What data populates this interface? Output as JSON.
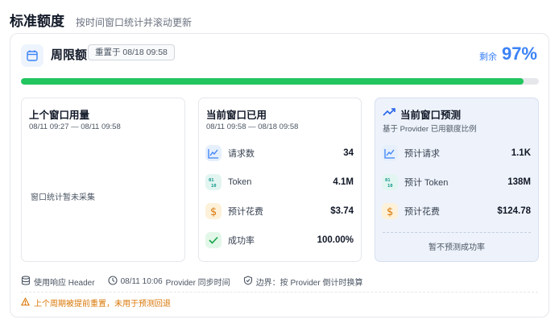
{
  "header": {
    "title": "标准额度",
    "subtitle": "按时间窗口统计并滚动更新"
  },
  "quota": {
    "title": "周限额",
    "reset_badge": "重置于 08/18 09:58",
    "remaining_label": "剩余",
    "remaining_value": "97%",
    "progress_fraction": 0.97,
    "progress_color": "#22c55e",
    "accent_color": "#3b82f6"
  },
  "previous_window": {
    "title": "上个窗口用量",
    "range": "08/11 09:27 — 08/11 09:58",
    "empty_text": "窗口统计暂未采集"
  },
  "current_window": {
    "title": "当前窗口已用",
    "range": "08/11 09:58 — 08/18 09:58",
    "rows": [
      {
        "icon": "chart-line-icon",
        "label": "请求数",
        "value": "34"
      },
      {
        "icon": "binary-icon",
        "label": "Token",
        "value": "4.1M"
      },
      {
        "icon": "dollar-icon",
        "label": "预计花费",
        "value": "$3.74"
      },
      {
        "icon": "check-icon",
        "label": "成功率",
        "value": "100.00%"
      }
    ]
  },
  "forecast": {
    "icon": "trend-up-icon",
    "title": "当前窗口预测",
    "subtitle": "基于 Provider 已用额度比例",
    "rows": [
      {
        "icon": "chart-line-icon",
        "label": "预计请求",
        "value": "1.1K"
      },
      {
        "icon": "binary-icon",
        "label": "预计 Token",
        "value": "138M"
      },
      {
        "icon": "dollar-icon",
        "label": "预计花费",
        "value": "$124.78"
      }
    ],
    "note": "暂不预测成功率"
  },
  "footer": {
    "source": "使用响应 Header",
    "time": "08/11 10:06",
    "sync": "Provider 同步时间",
    "boundary": "边界：按 Provider 倒计时换算",
    "warning": "上个周期被提前重置，未用于预测回退"
  }
}
